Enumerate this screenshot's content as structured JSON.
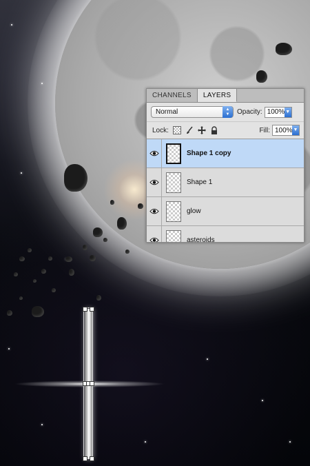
{
  "panel": {
    "tabs": [
      {
        "label": "CHANNELS",
        "active": false
      },
      {
        "label": "LAYERS",
        "active": true
      }
    ],
    "blend_mode": "Normal",
    "opacity_label": "Opacity:",
    "opacity_value": "100%",
    "lock_label": "Lock:",
    "lock_icons": [
      "lock-transparent-pixels-icon",
      "brush-icon",
      "move-icon",
      "lock-all-icon"
    ],
    "fill_label": "Fill:",
    "fill_value": "100%",
    "layers": [
      {
        "name": "Shape 1 copy",
        "selected": true,
        "visible": true
      },
      {
        "name": "Shape 1",
        "selected": false,
        "visible": true
      },
      {
        "name": "glow",
        "selected": false,
        "visible": true
      },
      {
        "name": "asteroids",
        "selected": false,
        "visible": true
      }
    ]
  },
  "colors": {
    "selection": "#bfd9f7",
    "stepper_blue": "#2b6fd1"
  }
}
